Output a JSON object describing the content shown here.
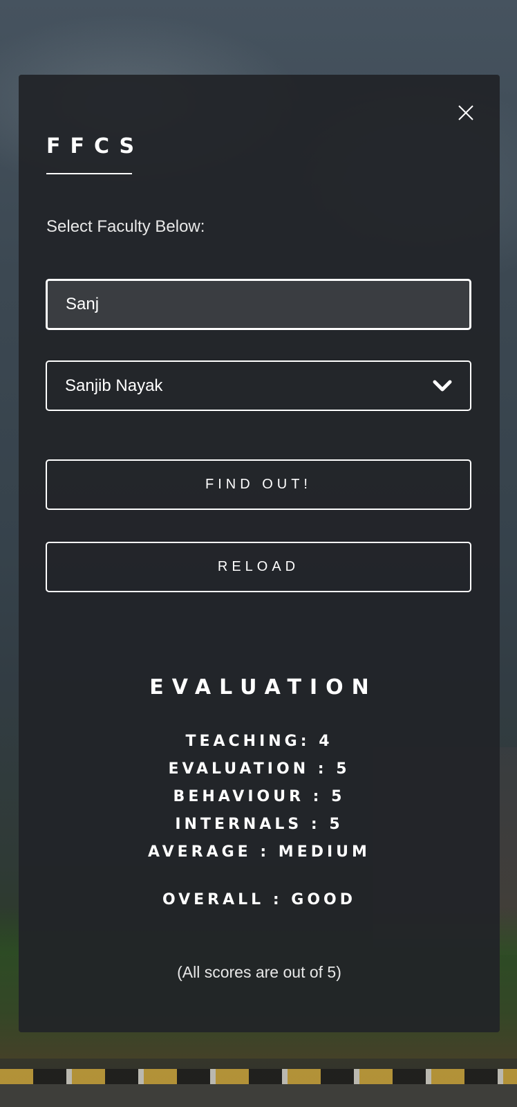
{
  "app": {
    "brand": "FFCS",
    "close_icon": "close-icon"
  },
  "form": {
    "label": "Select Faculty Below:",
    "search_value": "Sanj",
    "selected_faculty": "Sanjib Nayak",
    "select_icon": "chevron-down-icon",
    "find_button": "FIND OUT!",
    "reload_button": "RELOAD"
  },
  "evaluation": {
    "title": "EVALUATION",
    "lines": [
      "TEACHING: 4",
      "EVALUATION : 5",
      "BEHAVIOUR : 5",
      "INTERNALS : 5",
      "AVERAGE : MEDIUM"
    ],
    "overall": "OVERALL : GOOD",
    "note": "(All scores are out of 5)"
  },
  "colors": {
    "panel": "#212428",
    "text": "#ffffff",
    "input_bg": "#3a3d41"
  }
}
